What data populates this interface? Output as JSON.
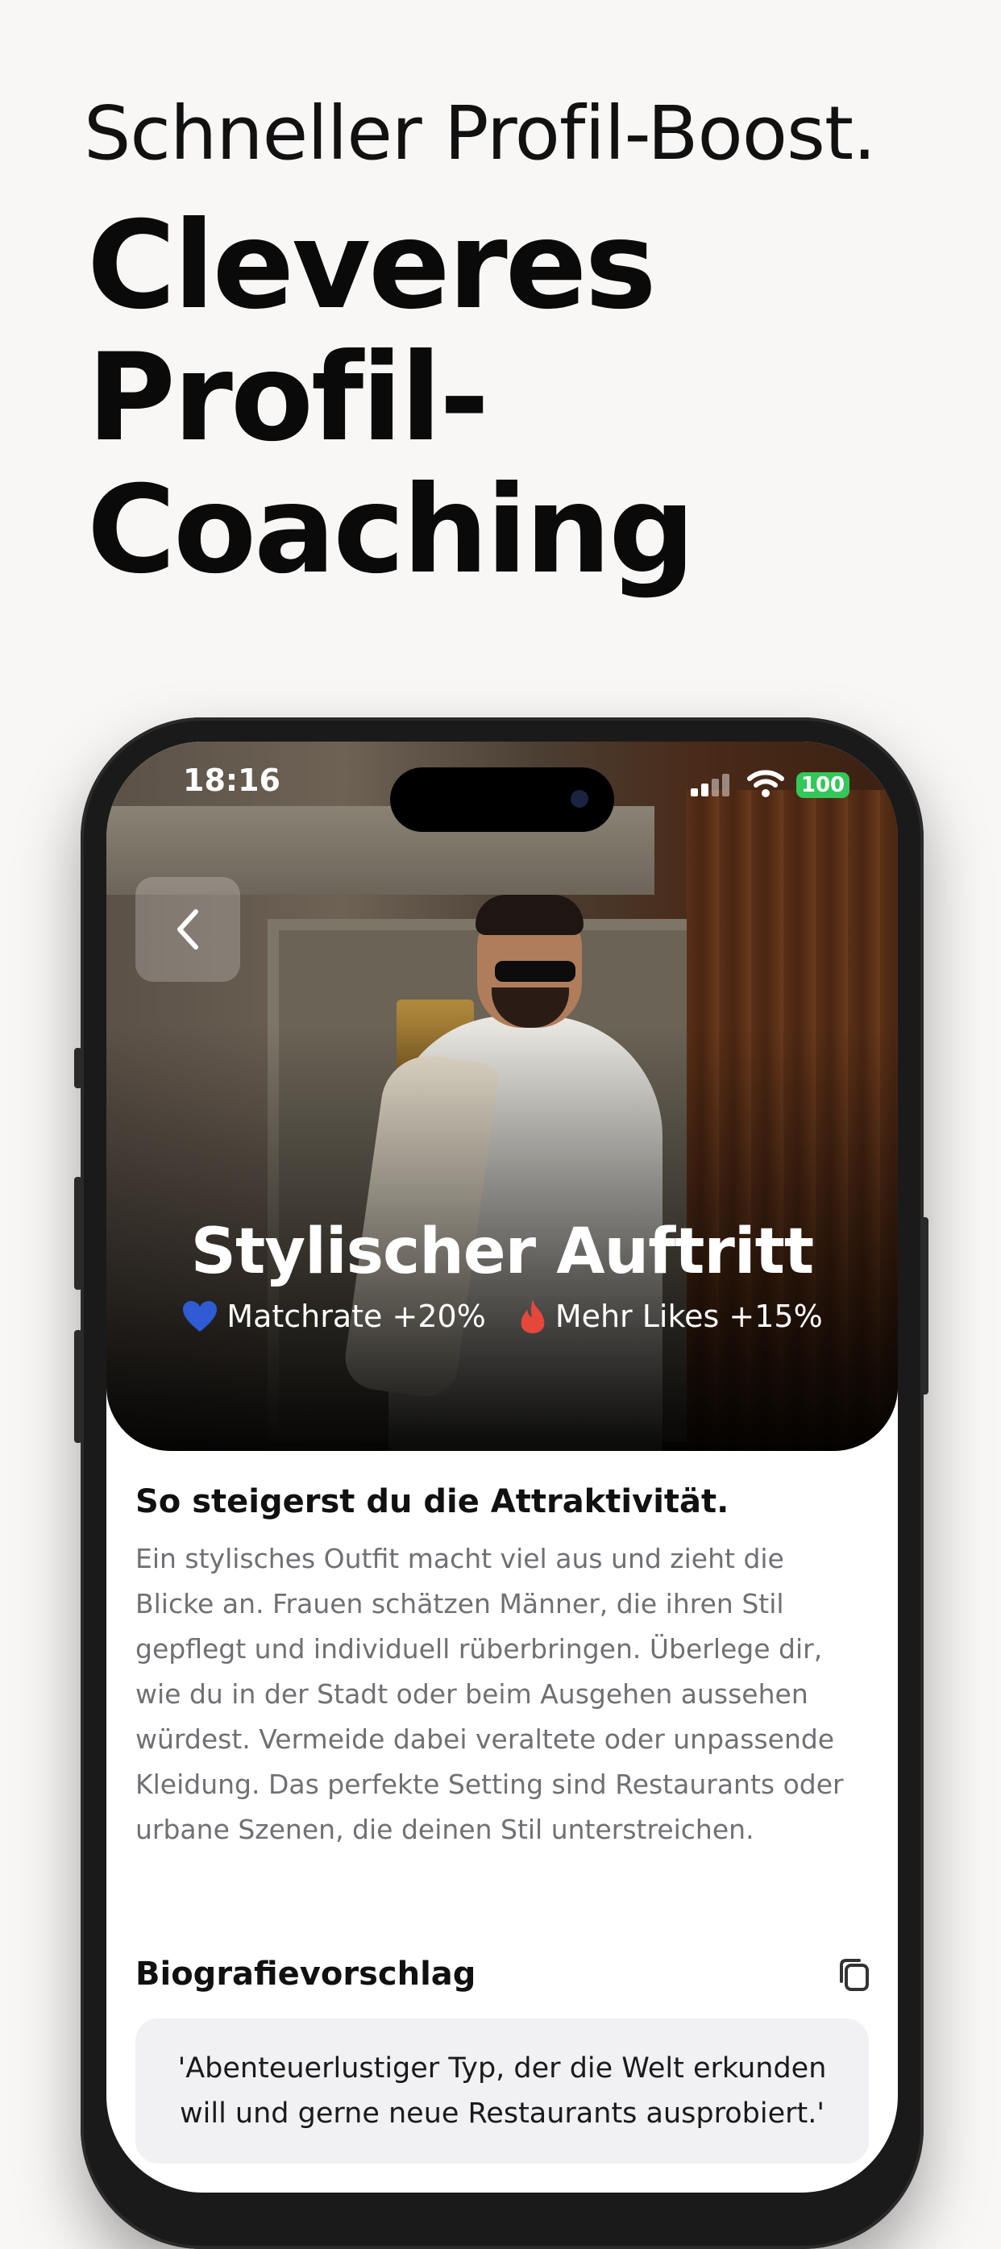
{
  "header": {
    "subtitle": "Schneller Profil-Boost.",
    "title_lines": [
      "Cleveres",
      "Profil-",
      "Coaching"
    ]
  },
  "status_bar": {
    "time": "18:16",
    "battery": "100",
    "battery_color": "#34c759"
  },
  "hero": {
    "title": "Stylischer Auftritt",
    "stats": [
      {
        "icon": "heart-icon",
        "label": "Matchrate +20%",
        "color": "#2f5bd3"
      },
      {
        "icon": "flame-icon",
        "label": "Mehr Likes +15%",
        "color": "#e5483b"
      }
    ]
  },
  "content": {
    "section_title": "So steigerst du die Attraktivität.",
    "description": "Ein stylisches Outfit macht viel aus und zieht die Blicke an. Frauen schätzen Männer, die ihren Stil gepflegt und individuell rüberbringen. Überlege dir, wie du in der Stadt oder beim Ausgehen aussehen würdest. Vermeide dabei veraltete oder unpassende Kleidung. Das perfekte Setting sind Restaurants oder urbane Szenen, die deinen Stil unterstreichen.",
    "bio_title": "Biografievorschlag",
    "bio_text": "'Abenteuerlustiger Typ, der die Welt erkunden will und gerne neue Restaurants ausprobiert.'"
  }
}
